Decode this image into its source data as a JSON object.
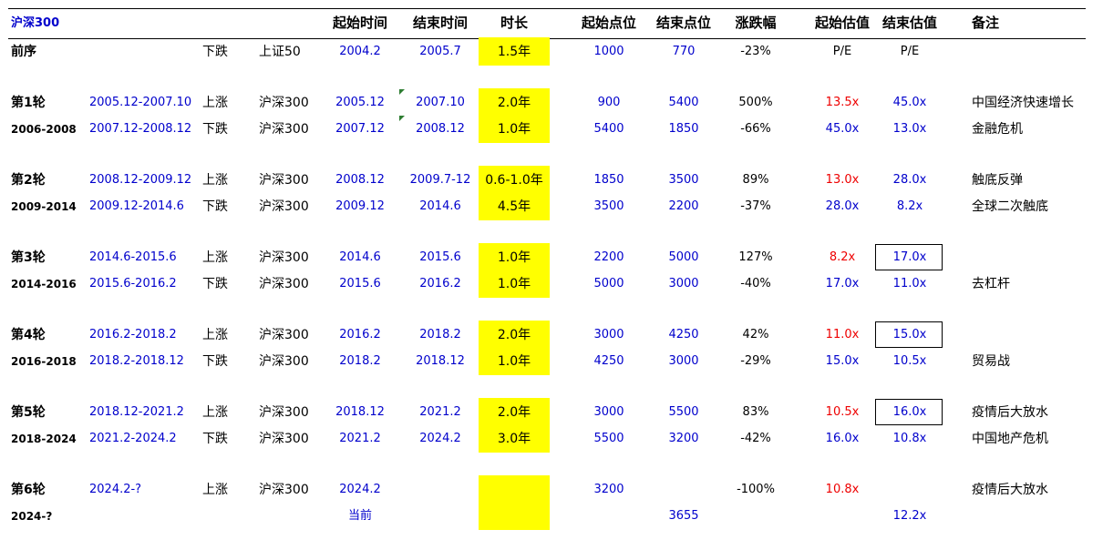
{
  "header": {
    "title": "沪深300",
    "start_time": "起始时间",
    "end_time": "结束时间",
    "duration": "时长",
    "start_point": "起始点位",
    "end_point": "结束点位",
    "change": "涨跌幅",
    "start_val": "起始估值",
    "end_val": "结束估值",
    "note": "备注"
  },
  "rows": [
    {
      "round": "前序",
      "period": "",
      "dir": "下跌",
      "index": "上证50",
      "start": "2004.2",
      "end": "2005.7",
      "dur": "1.5年",
      "sp": "1000",
      "ep": "770",
      "chg": "-23%",
      "sv": "P/E",
      "ev": "P/E",
      "note": ""
    },
    {
      "round": "第1轮",
      "period": "2005.12-2007.10",
      "dir": "上涨",
      "index": "沪深300",
      "start": "2005.12",
      "end": "2007.10",
      "dur": "2.0年",
      "sp": "900",
      "ep": "5400",
      "chg": "500%",
      "sv": "13.5x",
      "ev": "45.0x",
      "note": "中国经济快速增长"
    },
    {
      "round": "2006-2008",
      "period": "2007.12-2008.12",
      "dir": "下跌",
      "index": "沪深300",
      "start": "2007.12",
      "end": "2008.12",
      "dur": "1.0年",
      "sp": "5400",
      "ep": "1850",
      "chg": "-66%",
      "sv": "45.0x",
      "ev": "13.0x",
      "note": "金融危机"
    },
    {
      "round": "第2轮",
      "period": "2008.12-2009.12",
      "dir": "上涨",
      "index": "沪深300",
      "start": "2008.12",
      "end": "2009.7-12",
      "dur": "0.6-1.0年",
      "sp": "1850",
      "ep": "3500",
      "chg": "89%",
      "sv": "13.0x",
      "ev": "28.0x",
      "note": "触底反弹"
    },
    {
      "round": "2009-2014",
      "period": "2009.12-2014.6",
      "dir": "下跌",
      "index": "沪深300",
      "start": "2009.12",
      "end": "2014.6",
      "dur": "4.5年",
      "sp": "3500",
      "ep": "2200",
      "chg": "-37%",
      "sv": "28.0x",
      "ev": "8.2x",
      "note": "全球二次触底"
    },
    {
      "round": "第3轮",
      "period": "2014.6-2015.6",
      "dir": "上涨",
      "index": "沪深300",
      "start": "2014.6",
      "end": "2015.6",
      "dur": "1.0年",
      "sp": "2200",
      "ep": "5000",
      "chg": "127%",
      "sv": "8.2x",
      "ev": "17.0x",
      "note": ""
    },
    {
      "round": "2014-2016",
      "period": "2015.6-2016.2",
      "dir": "下跌",
      "index": "沪深300",
      "start": "2015.6",
      "end": "2016.2",
      "dur": "1.0年",
      "sp": "5000",
      "ep": "3000",
      "chg": "-40%",
      "sv": "17.0x",
      "ev": "11.0x",
      "note": "去杠杆"
    },
    {
      "round": "第4轮",
      "period": "2016.2-2018.2",
      "dir": "上涨",
      "index": "沪深300",
      "start": "2016.2",
      "end": "2018.2",
      "dur": "2.0年",
      "sp": "3000",
      "ep": "4250",
      "chg": "42%",
      "sv": "11.0x",
      "ev": "15.0x",
      "note": ""
    },
    {
      "round": "2016-2018",
      "period": "2018.2-2018.12",
      "dir": "下跌",
      "index": "沪深300",
      "start": "2018.2",
      "end": "2018.12",
      "dur": "1.0年",
      "sp": "4250",
      "ep": "3000",
      "chg": "-29%",
      "sv": "15.0x",
      "ev": "10.5x",
      "note": "贸易战"
    },
    {
      "round": "第5轮",
      "period": "2018.12-2021.2",
      "dir": "上涨",
      "index": "沪深300",
      "start": "2018.12",
      "end": "2021.2",
      "dur": "2.0年",
      "sp": "3000",
      "ep": "5500",
      "chg": "83%",
      "sv": "10.5x",
      "ev": "16.0x",
      "note": "疫情后大放水"
    },
    {
      "round": "2018-2024",
      "period": "2021.2-2024.2",
      "dir": "下跌",
      "index": "沪深300",
      "start": "2021.2",
      "end": "2024.2",
      "dur": "3.0年",
      "sp": "5500",
      "ep": "3200",
      "chg": "-42%",
      "sv": "16.0x",
      "ev": "10.8x",
      "note": "中国地产危机"
    },
    {
      "round": "第6轮",
      "period": "2024.2-?",
      "dir": "上涨",
      "index": "沪深300",
      "start": "2024.2",
      "end": "",
      "dur": "",
      "sp": "3200",
      "ep": "",
      "chg": "-100%",
      "sv": "10.8x",
      "ev": "",
      "note": "疫情后大放水"
    },
    {
      "round": "2024-?",
      "period": "",
      "dir": "",
      "index": "",
      "start": "当前",
      "end": "",
      "dur": "",
      "sp": "",
      "ep": "3655",
      "chg": "",
      "sv": "",
      "ev": "12.2x",
      "note": ""
    }
  ],
  "colors": {
    "blue_text": "#0000cc",
    "red_text": "#ee0000",
    "highlight": "#ffff00"
  }
}
